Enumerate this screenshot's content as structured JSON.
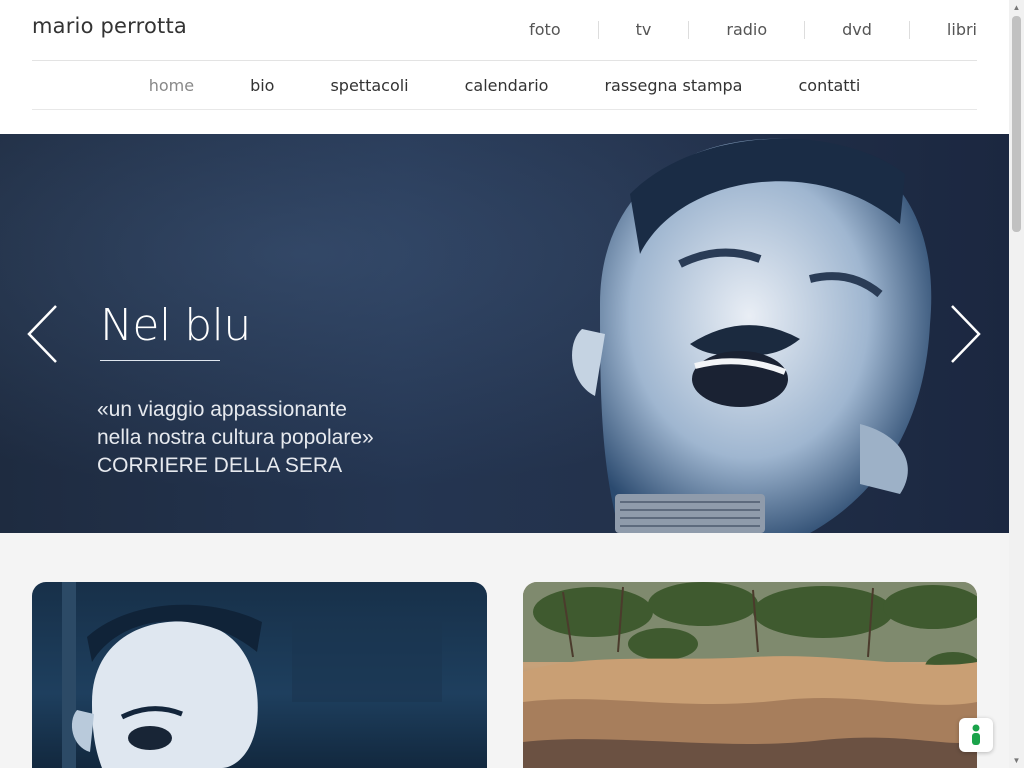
{
  "site": {
    "brand": "mario perrotta"
  },
  "top_nav": {
    "items": [
      {
        "label": "foto"
      },
      {
        "label": "tv"
      },
      {
        "label": "radio"
      },
      {
        "label": "dvd"
      },
      {
        "label": "libri"
      }
    ]
  },
  "main_nav": {
    "active": "home",
    "items": [
      {
        "label": "home"
      },
      {
        "label": "bio"
      },
      {
        "label": "spettacoli"
      },
      {
        "label": "calendario"
      },
      {
        "label": "rassegna stampa"
      },
      {
        "label": "contatti"
      }
    ]
  },
  "hero": {
    "title": "Nel blu",
    "quote_line1": "«un viaggio appassionante",
    "quote_line2": "nella nostra cultura popolare»",
    "source": "CORRIERE DELLA SERA",
    "prev_icon": "chevron-left-icon",
    "next_icon": "chevron-right-icon"
  },
  "cards": [
    {
      "image": "singer-portrait-blue"
    },
    {
      "image": "rocky-coast-pine-trees"
    }
  ],
  "widget": {
    "icon": "accessibility-icon",
    "color": "#1aa34a"
  },
  "colors": {
    "hero_bg": "#23324c",
    "card_bg": "#f4f4f4"
  }
}
